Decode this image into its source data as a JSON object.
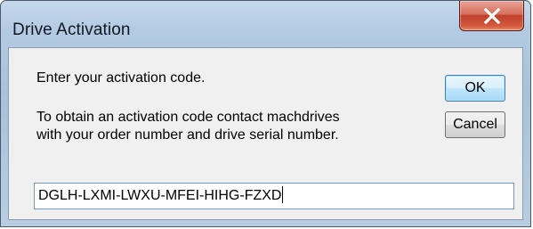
{
  "window": {
    "title": "Drive Activation"
  },
  "title_bar": {
    "close_icon": "close-x-icon"
  },
  "dialog": {
    "prompt": "Enter your activation code.",
    "info_line1": "To obtain an activation code contact machdrives",
    "info_line2": "with your order number and drive serial number.",
    "activation_code_value": "DGLH-LXMI-LWXU-MFEI-HIHG-FZXD"
  },
  "buttons": {
    "ok_label": "OK",
    "cancel_label": "Cancel"
  },
  "colors": {
    "title_bar": "#b4cbe3",
    "close_button": "#c0402c",
    "client_background": "#f0f0f0",
    "default_button_border": "#3c7fb1"
  }
}
